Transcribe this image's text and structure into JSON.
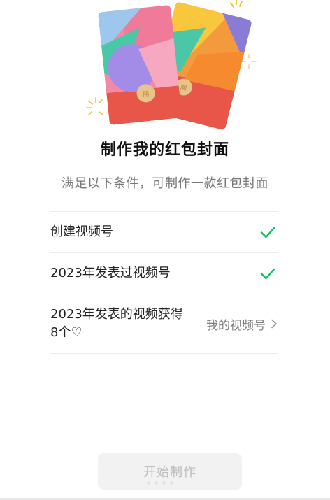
{
  "page": {
    "title": "制作我的红包封面",
    "subtitle": "满足以下条件，可制作一款红包封面"
  },
  "conditions": [
    {
      "label_lines": [
        "创建视频号"
      ],
      "status": "met"
    },
    {
      "label_lines": [
        "2023年发表过视频号"
      ],
      "status": "met"
    },
    {
      "label_lines": [
        "2023年发表的视频获得",
        "8个♡"
      ],
      "status": "unmet",
      "link_label": "我的视频号"
    }
  ],
  "cta": {
    "label": "开始制作",
    "enabled": false
  },
  "colors": {
    "check_green": "#07c160",
    "card_red": "#e8564a",
    "card_pink": "#f08aa8",
    "card_purple": "#a38be8",
    "card_teal": "#49c7a6",
    "card_yellow": "#f8c73c",
    "card_orange": "#f39a3c",
    "coin_gold": "#e8c488",
    "sparkle": "#f2c23a"
  },
  "icons": {
    "check": "check-icon",
    "chevron": "chevron-right-icon",
    "heart": "heart-outline"
  }
}
